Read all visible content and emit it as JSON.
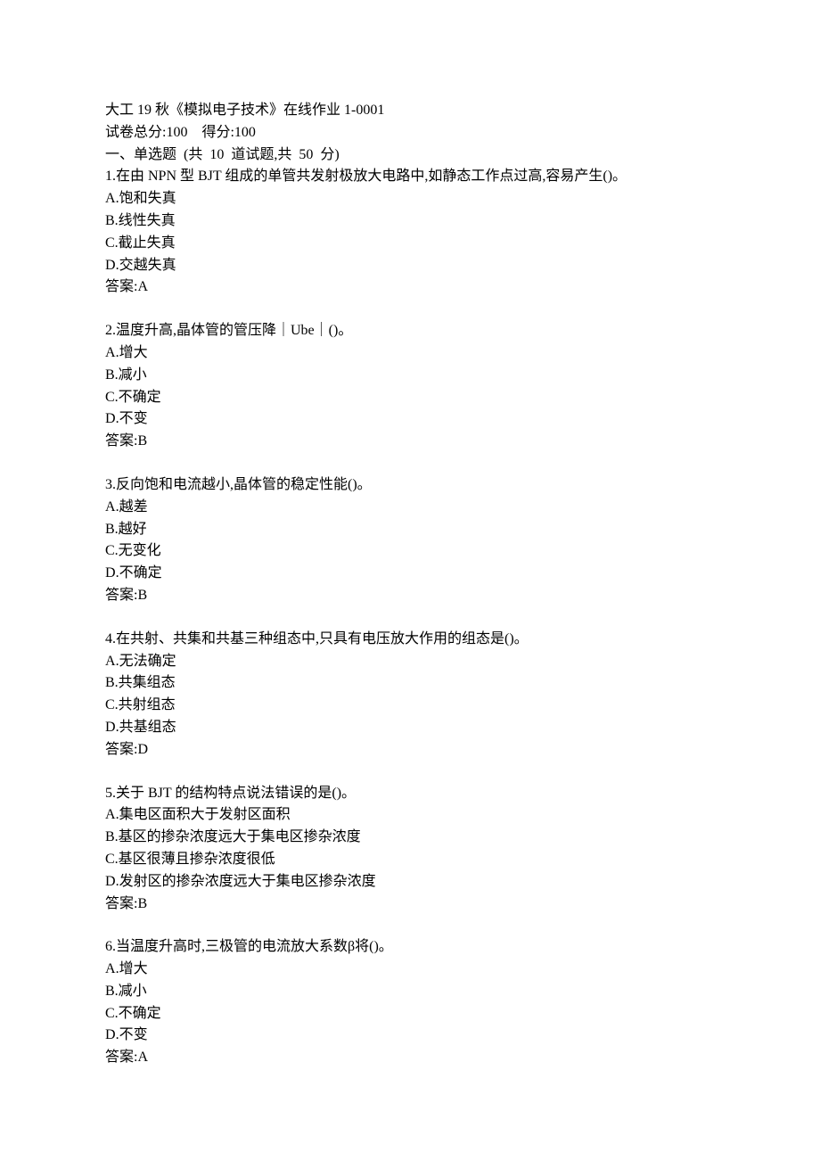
{
  "header": {
    "title": "大工 19 秋《模拟电子技术》在线作业 1-0001",
    "score_line": "试卷总分:100    得分:100",
    "section_title": "一、单选题  (共  10  道试题,共  50  分)"
  },
  "questions": [
    {
      "number": "1",
      "text": "在由 NPN 型 BJT 组成的单管共发射极放大电路中,如静态工作点过高,容易产生()。",
      "options": [
        {
          "label": "A",
          "text": "饱和失真"
        },
        {
          "label": "B",
          "text": "线性失真"
        },
        {
          "label": "C",
          "text": "截止失真"
        },
        {
          "label": "D",
          "text": "交越失真"
        }
      ],
      "answer_label": "答案:",
      "answer": "A"
    },
    {
      "number": "2",
      "text": "温度升高,晶体管的管压降｜Ube｜()。",
      "options": [
        {
          "label": "A",
          "text": "增大"
        },
        {
          "label": "B",
          "text": "减小"
        },
        {
          "label": "C",
          "text": "不确定"
        },
        {
          "label": "D",
          "text": "不变"
        }
      ],
      "answer_label": "答案:",
      "answer": "B"
    },
    {
      "number": "3",
      "text": "反向饱和电流越小,晶体管的稳定性能()。",
      "options": [
        {
          "label": "A",
          "text": "越差"
        },
        {
          "label": "B",
          "text": "越好"
        },
        {
          "label": "C",
          "text": "无变化"
        },
        {
          "label": "D",
          "text": "不确定"
        }
      ],
      "answer_label": "答案:",
      "answer": "B"
    },
    {
      "number": "4",
      "text": "在共射、共集和共基三种组态中,只具有电压放大作用的组态是()。",
      "options": [
        {
          "label": "A",
          "text": "无法确定"
        },
        {
          "label": "B",
          "text": "共集组态"
        },
        {
          "label": "C",
          "text": "共射组态"
        },
        {
          "label": "D",
          "text": "共基组态"
        }
      ],
      "answer_label": "答案:",
      "answer": "D"
    },
    {
      "number": "5",
      "text": "关于 BJT 的结构特点说法错误的是()。",
      "options": [
        {
          "label": "A",
          "text": "集电区面积大于发射区面积"
        },
        {
          "label": "B",
          "text": "基区的掺杂浓度远大于集电区掺杂浓度"
        },
        {
          "label": "C",
          "text": "基区很薄且掺杂浓度很低"
        },
        {
          "label": "D",
          "text": "发射区的掺杂浓度远大于集电区掺杂浓度"
        }
      ],
      "answer_label": "答案:",
      "answer": "B"
    },
    {
      "number": "6",
      "text": "当温度升高时,三极管的电流放大系数β将()。",
      "options": [
        {
          "label": "A",
          "text": "增大"
        },
        {
          "label": "B",
          "text": "减小"
        },
        {
          "label": "C",
          "text": "不确定"
        },
        {
          "label": "D",
          "text": "不变"
        }
      ],
      "answer_label": "答案:",
      "answer": "A"
    }
  ]
}
